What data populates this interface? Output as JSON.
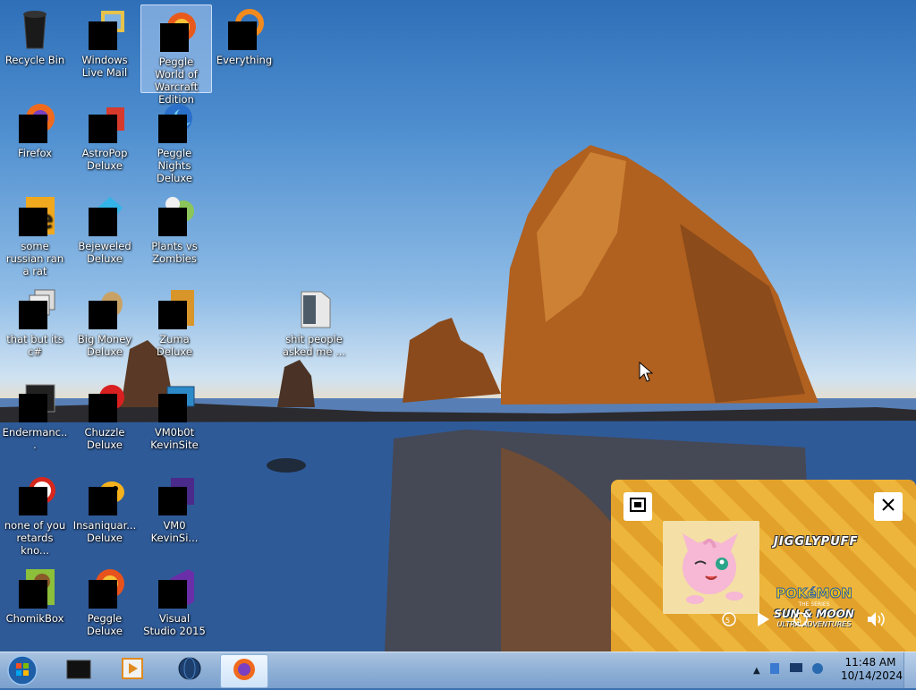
{
  "desktop": {
    "icons": [
      {
        "label": "Recycle Bin",
        "icon": "recycle-bin-icon"
      },
      {
        "label": "Windows Live Mail",
        "icon": "mail-icon"
      },
      {
        "label": "Peggle World of Warcraft Edition",
        "icon": "peggle-icon"
      },
      {
        "label": "Everything",
        "icon": "search-everything-icon"
      },
      {
        "label": "Firefox",
        "icon": "firefox-icon"
      },
      {
        "label": "AstroPop Deluxe",
        "icon": "astropop-icon"
      },
      {
        "label": "Peggle Nights Deluxe",
        "icon": "peggle-nights-icon"
      },
      {
        "label": "some russian ran a rat",
        "icon": "app-icon"
      },
      {
        "label": "Bejeweled Deluxe",
        "icon": "gem-icon"
      },
      {
        "label": "Plants vs Zombies",
        "icon": "plant-icon"
      },
      {
        "label": "that but its c#",
        "icon": "window-stack-icon"
      },
      {
        "label": "Big Money Deluxe",
        "icon": "money-bag-icon"
      },
      {
        "label": "Zuma Deluxe",
        "icon": "zuma-icon"
      },
      {
        "label": "shit people asked me ...",
        "icon": "folder-icon"
      },
      {
        "label": "Endermanc...",
        "icon": "terminal-icon"
      },
      {
        "label": "Chuzzle Deluxe",
        "icon": "chuzzle-icon"
      },
      {
        "label": "VM0b0t KevinSite",
        "icon": "vm-icon"
      },
      {
        "label": "none of you retards kno...",
        "icon": "app-icon"
      },
      {
        "label": "Insaniquar... Deluxe",
        "icon": "fish-icon"
      },
      {
        "label": "VM0 KevinSi...",
        "icon": "vm-icon"
      },
      {
        "label": "ChomikBox",
        "icon": "chomikbox-icon"
      },
      {
        "label": "Peggle Deluxe",
        "icon": "peggle-icon"
      },
      {
        "label": "Visual Studio 2015",
        "icon": "visual-studio-icon"
      }
    ]
  },
  "popup": {
    "character_name": "JIGGLYPUFF",
    "logo_top": "POKéMON",
    "logo_sub": "THE SERIES",
    "logo_title": "SUN & MOON",
    "logo_tag": "ULTRA ADVENTURES",
    "replay_label": "5",
    "forward_label": "5"
  },
  "taskbar": {
    "clock_time": "11:48 AM",
    "clock_date": "10/14/2024"
  },
  "colors": {
    "accent": "#edb53b",
    "taskbar": "#8fb0d6"
  }
}
